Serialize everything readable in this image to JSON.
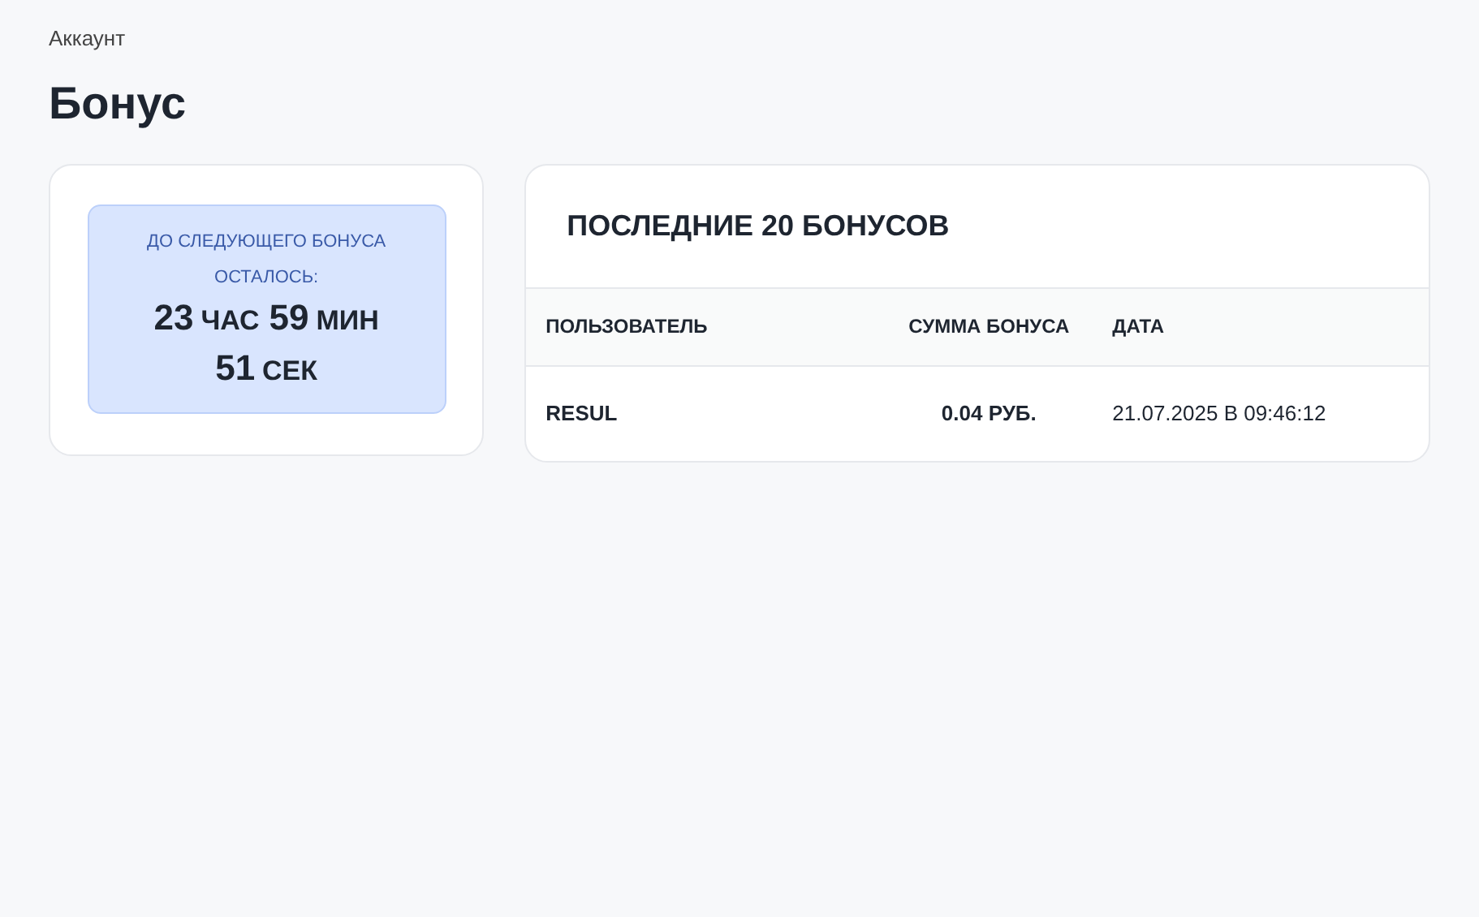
{
  "breadcrumb": "Аккаунт",
  "title": "Бонус",
  "countdown": {
    "label": "ДО СЛЕДУЮЩЕГО БОНУСА ОСТАЛОСЬ:",
    "parts": [
      {
        "value": "23",
        "unit": "ЧАС"
      },
      {
        "value": "59",
        "unit": "МИН"
      },
      {
        "value": "51",
        "unit": "СЕК"
      }
    ]
  },
  "history": {
    "title": "ПОСЛЕДНИЕ 20 БОНУСОВ",
    "columns": [
      "ПОЛЬЗОВАТЕЛЬ",
      "СУММА БОНУСА",
      "ДАТА"
    ],
    "rows": [
      {
        "user": "RESUL",
        "amount": "0.04 РУБ.",
        "date": "21.07.2025 В 09:46:12"
      }
    ]
  }
}
